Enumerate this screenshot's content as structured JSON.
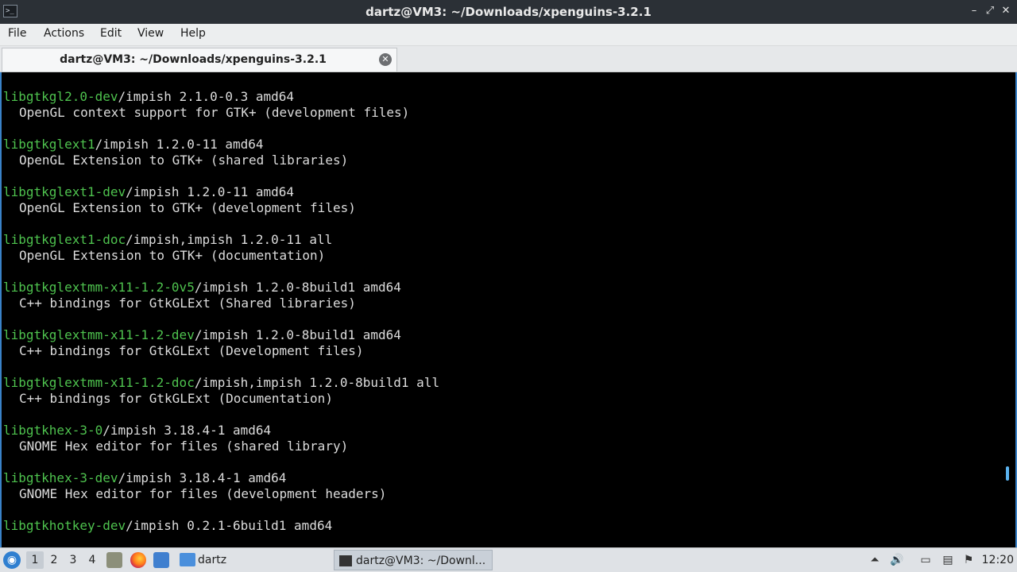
{
  "window": {
    "title": "dartz@VM3: ~/Downloads/xpenguins-3.2.1",
    "app_icon": ">_",
    "controls": {
      "minimize": "–",
      "maximize": "⤢",
      "close": "✕"
    }
  },
  "menu": [
    "File",
    "Actions",
    "Edit",
    "View",
    "Help"
  ],
  "tab": {
    "label": "dartz@VM3: ~/Downloads/xpenguins-3.2.1",
    "close_symbol": "✕"
  },
  "terminal": {
    "entries": [
      {
        "pkg": "libgtkgl2.0-dev",
        "rest": "/impish 2.1.0-0.3 amd64",
        "desc": "OpenGL context support for GTK+ (development files)"
      },
      {
        "pkg": "libgtkglext1",
        "rest": "/impish 1.2.0-11 amd64",
        "desc": "OpenGL Extension to GTK+ (shared libraries)"
      },
      {
        "pkg": "libgtkglext1-dev",
        "rest": "/impish 1.2.0-11 amd64",
        "desc": "OpenGL Extension to GTK+ (development files)"
      },
      {
        "pkg": "libgtkglext1-doc",
        "rest": "/impish,impish 1.2.0-11 all",
        "desc": "OpenGL Extension to GTK+ (documentation)"
      },
      {
        "pkg": "libgtkglextmm-x11-1.2-0v5",
        "rest": "/impish 1.2.0-8build1 amd64",
        "desc": "C++ bindings for GtkGLExt (Shared libraries)"
      },
      {
        "pkg": "libgtkglextmm-x11-1.2-dev",
        "rest": "/impish 1.2.0-8build1 amd64",
        "desc": "C++ bindings for GtkGLExt (Development files)"
      },
      {
        "pkg": "libgtkglextmm-x11-1.2-doc",
        "rest": "/impish,impish 1.2.0-8build1 all",
        "desc": "C++ bindings for GtkGLExt (Documentation)"
      },
      {
        "pkg": "libgtkhex-3-0",
        "rest": "/impish 3.18.4-1 amd64",
        "desc": "GNOME Hex editor for files (shared library)"
      },
      {
        "pkg": "libgtkhex-3-dev",
        "rest": "/impish 3.18.4-1 amd64",
        "desc": "GNOME Hex editor for files (development headers)"
      },
      {
        "pkg": "libgtkhotkey-dev",
        "rest": "/impish 0.2.1-6build1 amd64",
        "desc": ""
      }
    ]
  },
  "taskbar": {
    "workspaces": [
      "1",
      "2",
      "3",
      "4"
    ],
    "folder_label": "dartz",
    "task_label": "dartz@VM3: ~/Downl...",
    "clock": "12:20",
    "colors": {
      "pkg_green": "#4ec24e",
      "accent_blue": "#3a82c8"
    }
  }
}
